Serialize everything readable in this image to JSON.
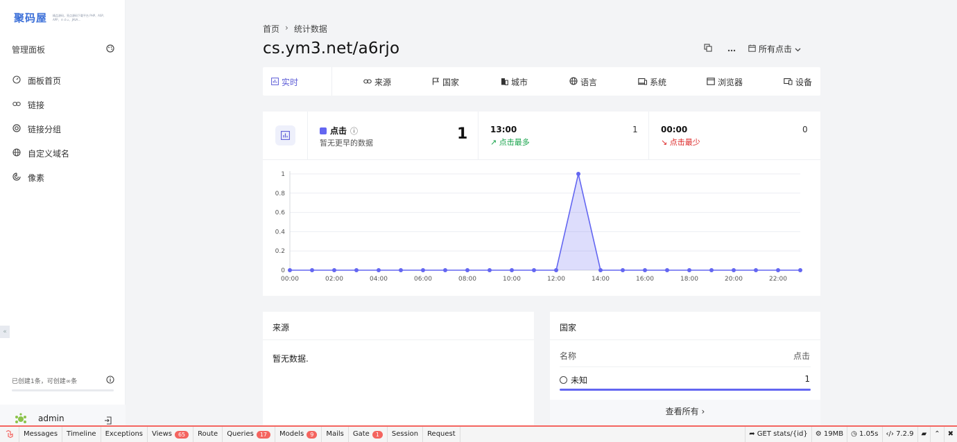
{
  "sidebar": {
    "logo_main": "聚码屋",
    "logo_sub": "精品源码，亮点源码下载平台 PHP、ASP、APP、Ｅｄｕ、JAVA…",
    "section_title": "管理面板",
    "items": [
      {
        "label": "面板首页",
        "icon": "dashboard-icon"
      },
      {
        "label": "链接",
        "icon": "link-icon"
      },
      {
        "label": "链接分组",
        "icon": "target-icon"
      },
      {
        "label": "自定义域名",
        "icon": "globe-icon"
      },
      {
        "label": "像素",
        "icon": "pixel-icon"
      }
    ],
    "quota_text": "已创建1条，可创建∞条",
    "username": "admin"
  },
  "breadcrumb": {
    "home": "首页",
    "current": "统计数据"
  },
  "title": "cs.ym3.net/a6rjo",
  "filter_label": "所有点击",
  "tabs": [
    {
      "label": "实时",
      "icon": "chart-icon",
      "active": true
    },
    {
      "label": "来源",
      "icon": "link-icon"
    },
    {
      "label": "国家",
      "icon": "flag-icon"
    },
    {
      "label": "城市",
      "icon": "building-icon"
    },
    {
      "label": "语言",
      "icon": "globe-icon"
    },
    {
      "label": "系统",
      "icon": "laptop-icon"
    },
    {
      "label": "浏览器",
      "icon": "window-icon"
    },
    {
      "label": "设备",
      "icon": "device-icon"
    }
  ],
  "stats": {
    "series_name": "点击",
    "series_sub": "暂无更早的数据",
    "total": "1",
    "max_time": "13:00",
    "max_value": "1",
    "max_note": "点击最多",
    "min_time": "00:00",
    "min_value": "0",
    "min_note": "点击最少",
    "accent": "#6366f1"
  },
  "chart_data": {
    "type": "area",
    "x": [
      "00:00",
      "01:00",
      "02:00",
      "03:00",
      "04:00",
      "05:00",
      "06:00",
      "07:00",
      "08:00",
      "09:00",
      "10:00",
      "11:00",
      "12:00",
      "13:00",
      "14:00",
      "15:00",
      "16:00",
      "17:00",
      "18:00",
      "19:00",
      "20:00",
      "21:00",
      "22:00",
      "23:00"
    ],
    "x_tick_labels": [
      "00:00",
      "02:00",
      "04:00",
      "06:00",
      "08:00",
      "10:00",
      "12:00",
      "14:00",
      "16:00",
      "18:00",
      "20:00",
      "22:00"
    ],
    "series": [
      {
        "values": [
          0,
          0,
          0,
          0,
          0,
          0,
          0,
          0,
          0,
          0,
          0,
          0,
          0,
          1,
          0,
          0,
          0,
          0,
          0,
          0,
          0,
          0,
          0,
          0
        ]
      }
    ],
    "y_ticks": [
      "0",
      "0.2",
      "0.4",
      "0.6",
      "0.8",
      "1"
    ],
    "ylim": [
      0,
      1
    ],
    "grid": true
  },
  "referrers": {
    "title": "来源",
    "empty": "暂无数据."
  },
  "countries": {
    "title": "国家",
    "col_name": "名称",
    "col_clicks": "点击",
    "rows": [
      {
        "name": "未知",
        "value": "1",
        "share": 1.0
      }
    ],
    "view_all": "查看所有"
  },
  "debugbar": {
    "tabs": [
      {
        "label": "Messages"
      },
      {
        "label": "Timeline"
      },
      {
        "label": "Exceptions"
      },
      {
        "label": "Views",
        "badge": "65"
      },
      {
        "label": "Route"
      },
      {
        "label": "Queries",
        "badge": "17"
      },
      {
        "label": "Models",
        "badge": "9"
      },
      {
        "label": "Mails"
      },
      {
        "label": "Gate",
        "badge": "1"
      },
      {
        "label": "Session"
      },
      {
        "label": "Request"
      }
    ],
    "route": "GET stats/{id}",
    "memory": "19MB",
    "time": "1.05s",
    "php": "7.2.9"
  }
}
